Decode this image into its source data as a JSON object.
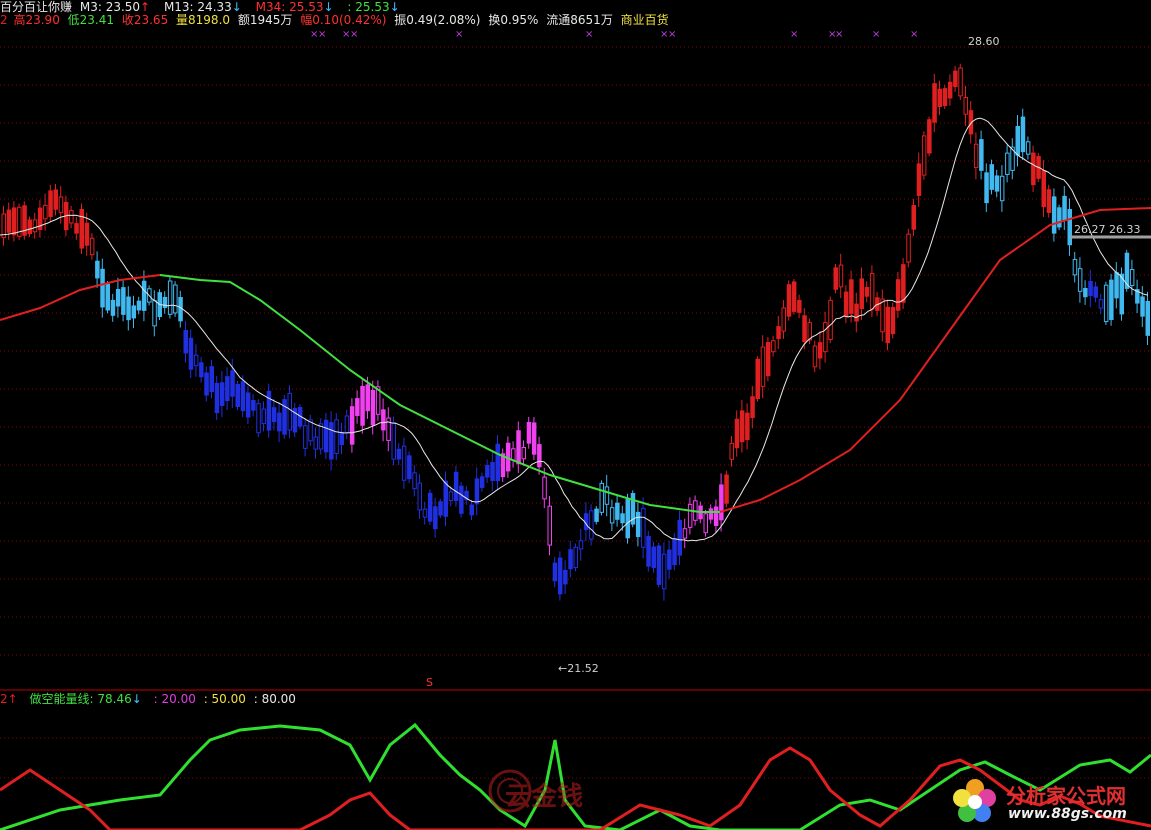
{
  "header": {
    "line1": {
      "stock": "百分百让你赚",
      "m3": "M3: 23.50",
      "m3_arrow": "↑",
      "m13": "M13: 24.33",
      "m13_arrow": "↓",
      "m34": "M34: 25.53",
      "m34_arrow": "↓",
      "extra": ": 25.53",
      "extra_arrow": "↓"
    },
    "line2": {
      "prefix": "2",
      "high": "高23.90",
      "low": "低23.41",
      "close": "收23.65",
      "vol": "量8198.0",
      "amount": "额1945万",
      "chg": "幅0.10(0.42%)",
      "amp": "振0.49(2.08%)",
      "turnover": "换0.95%",
      "float": "流通8651万",
      "sector": "商业百货"
    }
  },
  "labels": {
    "high_price": "28.60",
    "low_price": "←21.52",
    "right_values": "26.27 26.33",
    "signal_s": "S"
  },
  "indicator": {
    "prefix": "2↑",
    "name": "做空能量线: 78.46",
    "name_arrow": "↓",
    "l20": ": 20.00",
    "l50": ": 50.00",
    "l80": ": 80.00"
  },
  "watermarks": {
    "center": "云金钱",
    "logo_text": "分析家公式网",
    "logo_url": "www.88gs.com"
  },
  "colors": {
    "up": "#e02020",
    "down_light": "#40b8f0",
    "down_dark": "#2030e0",
    "magenta": "#f040f0",
    "ma_long_red": "#e02020",
    "ma_long_green": "#40e040",
    "ma_short": "#e8e8e8",
    "grid": "#8a0000"
  }
}
